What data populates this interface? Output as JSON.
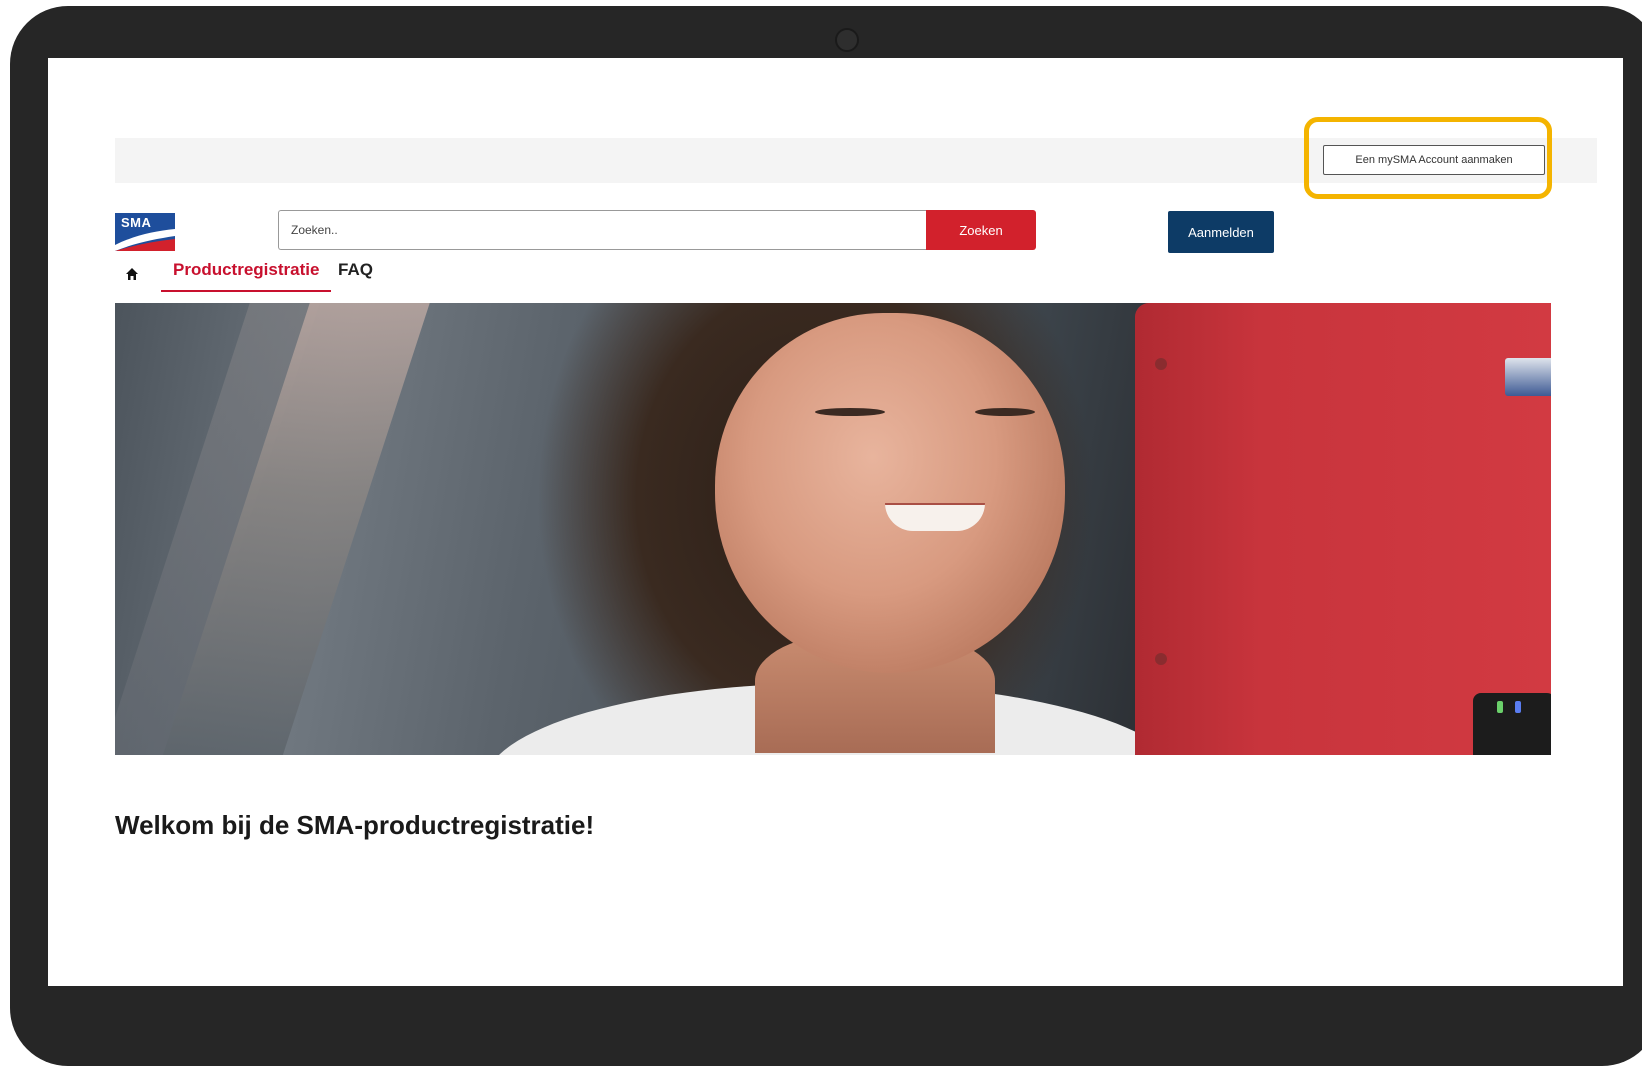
{
  "header": {
    "create_account_label": "Een mySMA Account aanmaken",
    "logo_text": "SMA",
    "search_placeholder": "Zoeken..",
    "search_button_label": "Zoeken",
    "login_button_label": "Aanmelden"
  },
  "nav": {
    "home_icon": "home-icon",
    "items": [
      {
        "label": "Productregistratie",
        "active": true
      },
      {
        "label": "FAQ",
        "active": false
      }
    ]
  },
  "main": {
    "welcome_heading": "Welkom bij de SMA-productregistratie!"
  },
  "colors": {
    "brand_red": "#d2212c",
    "brand_blue": "#0d3b66",
    "highlight": "#f4b400"
  }
}
